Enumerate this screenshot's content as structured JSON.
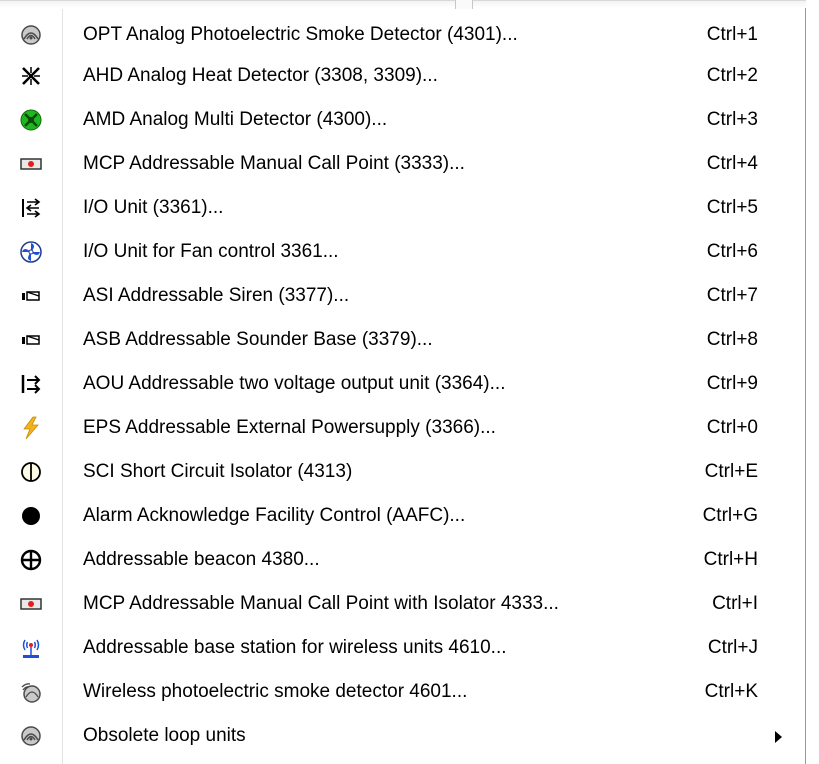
{
  "menu": {
    "items": [
      {
        "label": "OPT Analog Photoelectric Smoke Detector (4301)...",
        "shortcut": "Ctrl+1",
        "icon": "smoke-detector-icon"
      },
      {
        "label": "AHD Analog Heat Detector (3308, 3309)...",
        "shortcut": "Ctrl+2",
        "icon": "heat-detector-icon"
      },
      {
        "label": "AMD Analog Multi Detector (4300)...",
        "shortcut": "Ctrl+3",
        "icon": "multi-detector-icon"
      },
      {
        "label": "MCP Addressable Manual Call Point (3333)...",
        "shortcut": "Ctrl+4",
        "icon": "manual-call-point-icon"
      },
      {
        "label": "I/O Unit (3361)...",
        "shortcut": "Ctrl+5",
        "icon": "io-unit-icon"
      },
      {
        "label": "I/O Unit for Fan control 3361...",
        "shortcut": "Ctrl+6",
        "icon": "fan-control-icon"
      },
      {
        "label": "ASI Addressable Siren (3377)...",
        "shortcut": "Ctrl+7",
        "icon": "siren-icon"
      },
      {
        "label": "ASB Addressable Sounder Base (3379)...",
        "shortcut": "Ctrl+8",
        "icon": "sounder-base-icon"
      },
      {
        "label": "AOU Addressable two voltage output unit (3364)...",
        "shortcut": "Ctrl+9",
        "icon": "output-unit-icon"
      },
      {
        "label": "EPS Addressable External Powersupply (3366)...",
        "shortcut": "Ctrl+0",
        "icon": "lightning-icon"
      },
      {
        "label": "SCI Short Circuit Isolator (4313)",
        "shortcut": "Ctrl+E",
        "icon": "isolator-icon"
      },
      {
        "label": "Alarm Acknowledge Facility Control (AAFC)...",
        "shortcut": "Ctrl+G",
        "icon": "black-dot-icon"
      },
      {
        "label": "Addressable beacon 4380...",
        "shortcut": "Ctrl+H",
        "icon": "beacon-icon"
      },
      {
        "label": "MCP Addressable Manual Call Point with Isolator 4333...",
        "shortcut": "Ctrl+I",
        "icon": "manual-call-point-icon"
      },
      {
        "label": "Addressable base station for wireless units 4610...",
        "shortcut": "Ctrl+J",
        "icon": "base-station-icon"
      },
      {
        "label": "Wireless photoelectric smoke detector 4601...",
        "shortcut": "Ctrl+K",
        "icon": "wireless-detector-icon"
      },
      {
        "label": "Obsolete loop units",
        "shortcut": "",
        "icon": "smoke-detector-icon",
        "submenu": true
      }
    ]
  },
  "colors": {
    "text": "#000000",
    "separator": "#e2e3e3",
    "accent_green": "#22b522",
    "accent_red": "#e81b1b",
    "accent_blue": "#1f4fd6",
    "accent_yellow": "#f2b31d"
  }
}
